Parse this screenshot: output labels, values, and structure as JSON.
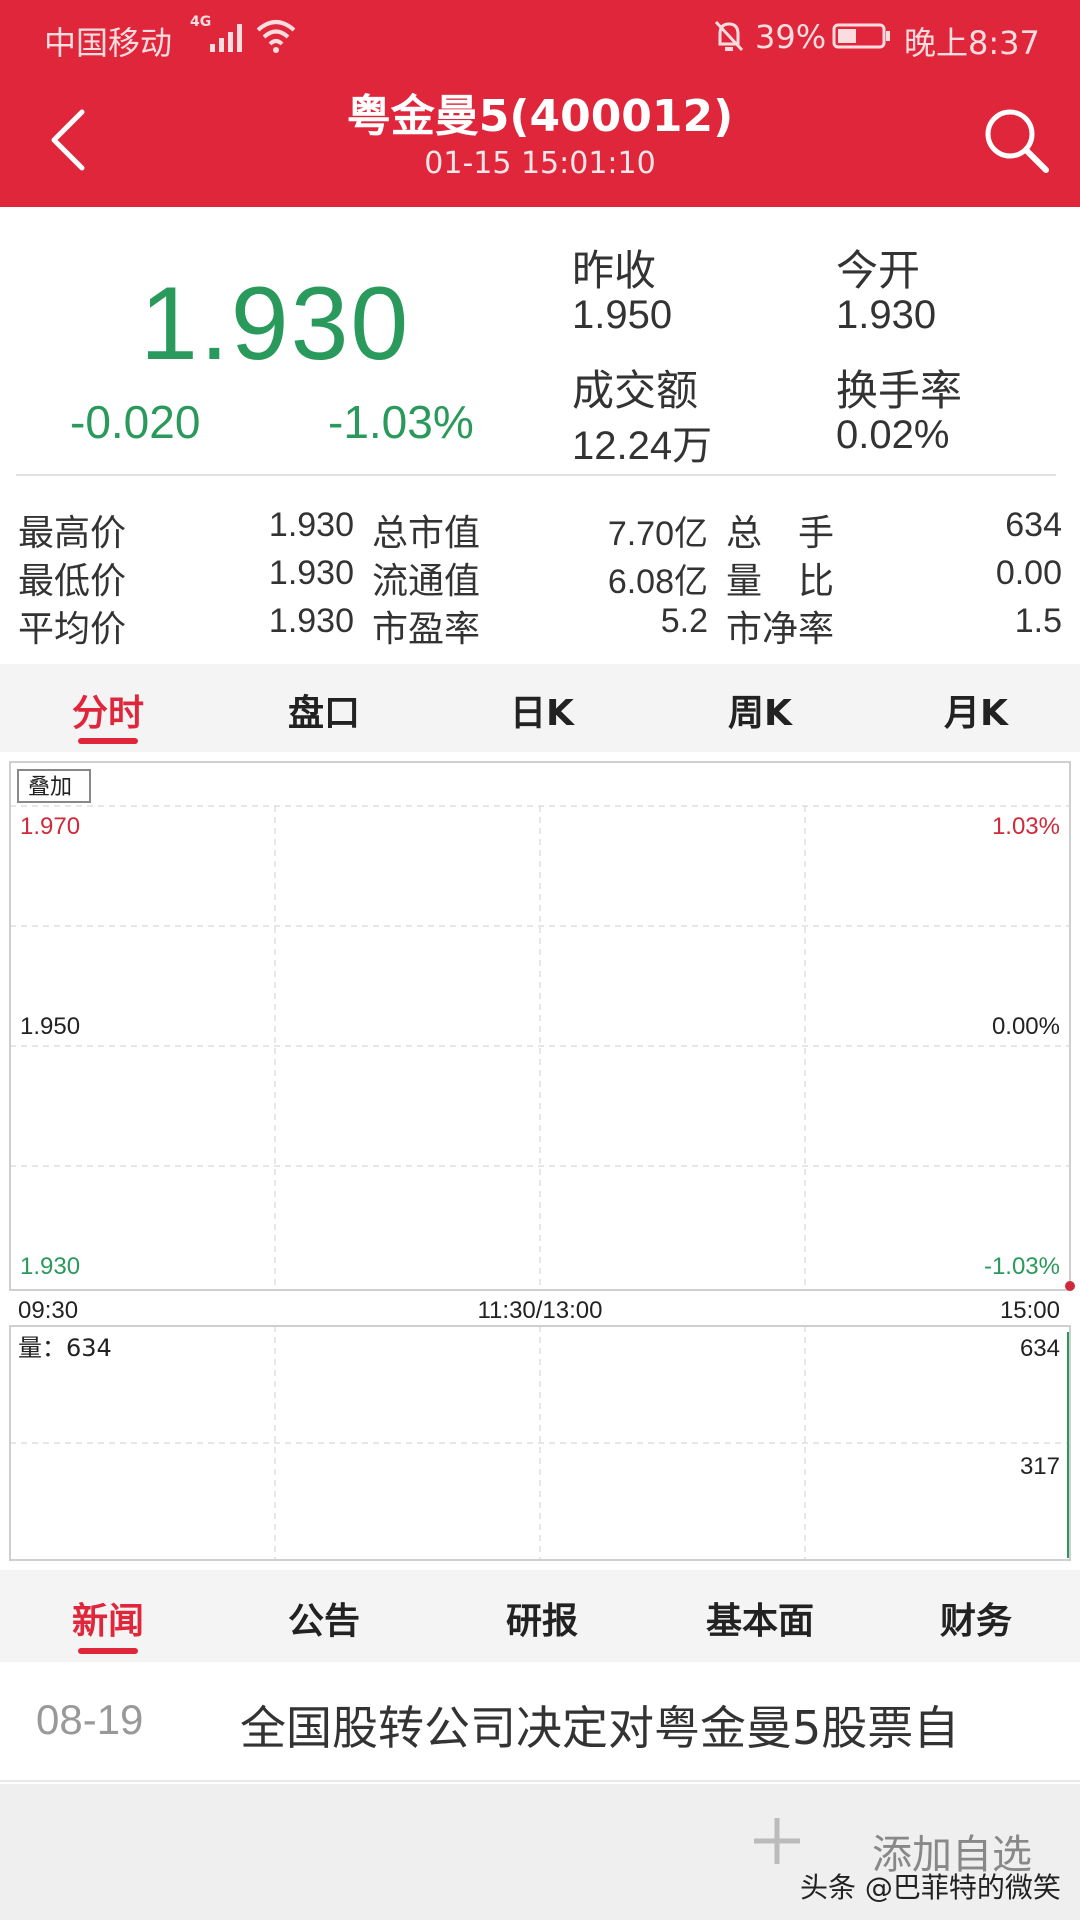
{
  "status_bar": {
    "carrier": "中国移动",
    "network": "4G",
    "battery": "39%",
    "time": "晚上8:37"
  },
  "header": {
    "title": "粤金曼5(400012)",
    "subtitle": "01-15 15:01:10",
    "back_icon": "chevron-left-icon",
    "search_icon": "search-icon"
  },
  "quote": {
    "price": "1.930",
    "change_abs": "-0.020",
    "change_pct": "-1.03%",
    "prev_close_label": "昨收",
    "prev_close": "1.950",
    "open_label": "今开",
    "open": "1.930",
    "turnover_label": "成交额",
    "turnover": "12.24万",
    "turnover_rate_label": "换手率",
    "turnover_rate": "0.02%"
  },
  "stats": [
    {
      "label": "最高价",
      "value": "1.930",
      "label2": "总市值",
      "value2": "7.70亿",
      "label3": "总　手",
      "value3": "634"
    },
    {
      "label": "最低价",
      "value": "1.930",
      "label2": "流通值",
      "value2": "6.08亿",
      "label3": "量　比",
      "value3": "0.00"
    },
    {
      "label": "平均价",
      "value": "1.930",
      "label2": "市盈率",
      "value2": "5.2",
      "label3": "市净率",
      "value3": "1.5"
    }
  ],
  "chart_tabs": [
    "分时",
    "盘口",
    "日K",
    "周K",
    "月K"
  ],
  "chart": {
    "overlay_button": "叠加",
    "y_left": [
      "1.970",
      "1.950",
      "1.930"
    ],
    "y_right": [
      "1.03%",
      "0.00%",
      "-1.03%"
    ],
    "x_labels": [
      "09:30",
      "11:30/13:00",
      "15:00"
    ],
    "volume_label": "量：634",
    "volume_right": [
      "634",
      "317"
    ]
  },
  "chart_data": {
    "type": "line",
    "x": [
      "09:30",
      "11:30/13:00",
      "15:00"
    ],
    "ylim": [
      1.93,
      1.97
    ],
    "series": [
      {
        "values": [
          1.93,
          1.93,
          1.93
        ]
      }
    ],
    "volume": {
      "values": [
        634
      ],
      "ylim": [
        0,
        634
      ]
    },
    "colors": {
      "up": "#d0293a",
      "down": "#2a9a5c",
      "grid": "#cfcfcf"
    }
  },
  "news_tabs": [
    "新闻",
    "公告",
    "研报",
    "基本面",
    "财务"
  ],
  "news": {
    "date": "08-19",
    "title": "全国股转公司决定对粤金曼5股票自"
  },
  "footer": {
    "add_label": "添加自选",
    "watermark": "头条 @巴菲特的微笑"
  },
  "colors": {
    "brand_red": "#e0263a",
    "down_green": "#2a9a5c"
  }
}
